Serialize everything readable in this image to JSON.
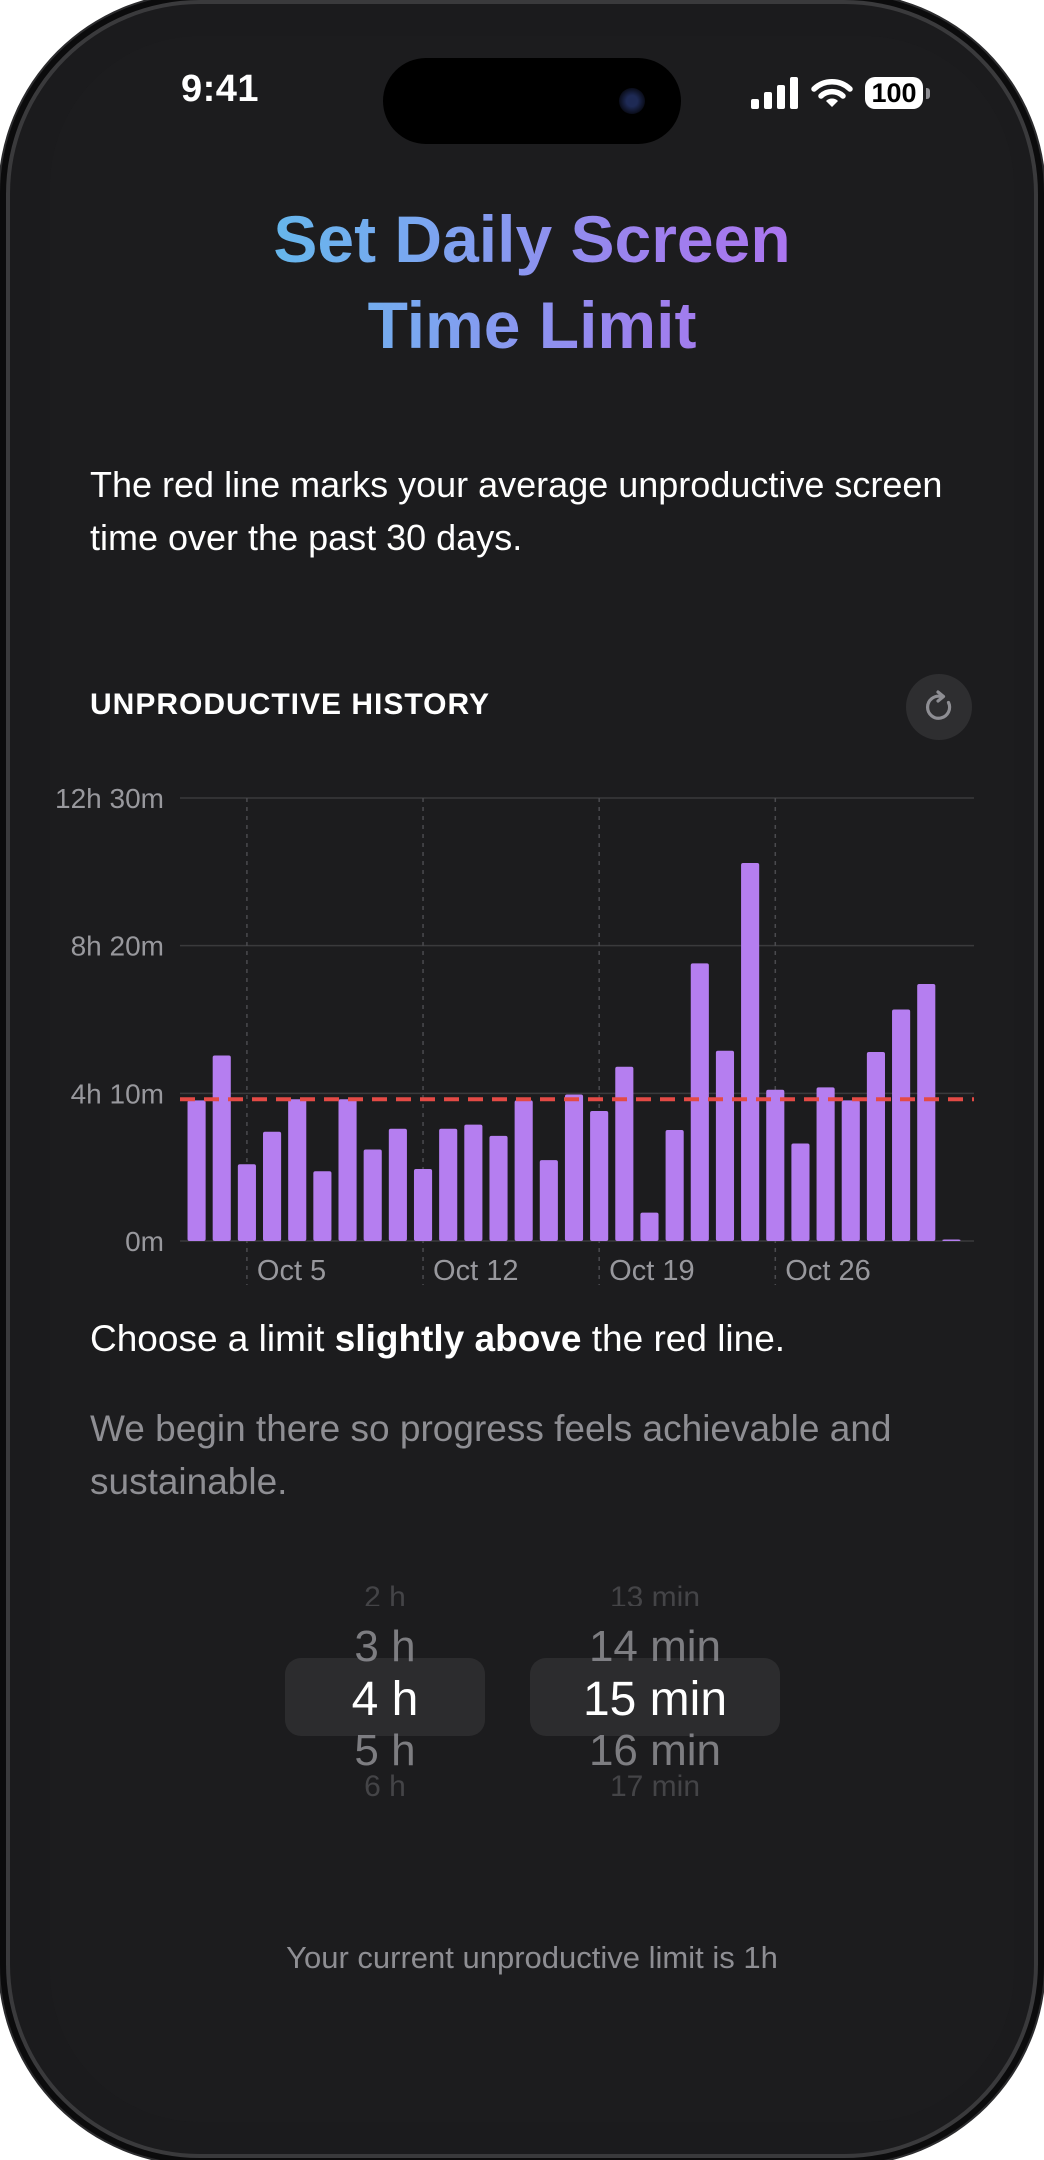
{
  "status_bar": {
    "time": "9:41",
    "battery": "100"
  },
  "title_line1": "Set Daily Screen",
  "title_line2": "Time Limit",
  "intro": "The red line marks your average unproductive screen time over the past 30 days.",
  "section_label": "UNPRODUCTIVE HISTORY",
  "refresh_icon": "refresh-icon",
  "choose": {
    "before": "Choose a limit ",
    "bold": "slightly above",
    "after": " the red line."
  },
  "explanation": "We begin there so progress feels achievable and sustainable.",
  "picker": {
    "hours": [
      "2 h",
      "3 h",
      "4 h",
      "5 h",
      "6 h"
    ],
    "minutes": [
      "13 min",
      "14 min",
      "15 min",
      "16 min",
      "17 min"
    ],
    "selected_hours": "4 h",
    "selected_minutes": "15 min"
  },
  "footer": "Your current unproductive limit is 1h",
  "colors": {
    "bar": "#b57ef0",
    "average_line": "#e34a45",
    "background": "#1c1c1e"
  },
  "chart_data": {
    "type": "bar",
    "title": "UNPRODUCTIVE HISTORY",
    "y_unit": "minutes",
    "ylim": [
      0,
      750
    ],
    "y_ticks": [
      {
        "value": 0,
        "label": "0m"
      },
      {
        "value": 250,
        "label": "4h 10m"
      },
      {
        "value": 500,
        "label": "8h 20m"
      },
      {
        "value": 750,
        "label": "12h 30m"
      }
    ],
    "x_ticks": [
      "Oct 5",
      "Oct 12",
      "Oct 19",
      "Oct 26"
    ],
    "dates": [
      "Oct 3",
      "Oct 4",
      "Oct 5",
      "Oct 6",
      "Oct 7",
      "Oct 8",
      "Oct 9",
      "Oct 10",
      "Oct 11",
      "Oct 12",
      "Oct 13",
      "Oct 14",
      "Oct 15",
      "Oct 16",
      "Oct 17",
      "Oct 18",
      "Oct 19",
      "Oct 20",
      "Oct 21",
      "Oct 22",
      "Oct 23",
      "Oct 24",
      "Oct 25",
      "Oct 26",
      "Oct 27",
      "Oct 28",
      "Oct 29",
      "Oct 30",
      "Oct 31",
      "Nov 1",
      "Nov 2"
    ],
    "values": [
      238,
      314,
      130,
      185,
      240,
      118,
      240,
      155,
      190,
      122,
      190,
      197,
      178,
      238,
      137,
      248,
      220,
      295,
      48,
      188,
      470,
      322,
      640,
      256,
      165,
      260,
      238,
      320,
      392,
      435,
      1
    ],
    "average": 240,
    "average_style": "dashed red line",
    "grid": true
  }
}
